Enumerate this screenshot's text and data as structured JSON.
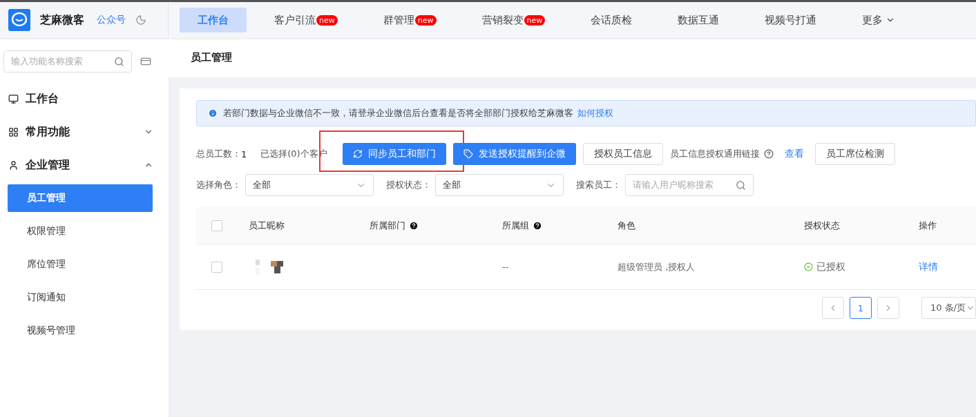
{
  "app": {
    "name": "芝麻微客",
    "account_link": "公众号"
  },
  "nav": [
    {
      "label": "工作台",
      "selected": true
    },
    {
      "label": "客户引流",
      "selected": false,
      "badge": "new"
    },
    {
      "label": "群管理",
      "selected": false,
      "badge": "new"
    },
    {
      "label": "营销裂变",
      "selected": false,
      "badge": "new"
    },
    {
      "label": "会话质检",
      "selected": false
    },
    {
      "label": "数据互通",
      "selected": false
    },
    {
      "label": "视频号打通",
      "selected": false
    },
    {
      "label": "更多",
      "selected": false,
      "dropdown": true
    }
  ],
  "sidebar": {
    "search_placeholder": "输入功能名称搜索",
    "items": [
      {
        "label": "工作台",
        "kind": "link"
      },
      {
        "label": "常用功能",
        "kind": "group",
        "expanded": false
      },
      {
        "label": "企业管理",
        "kind": "group",
        "expanded": true,
        "children": [
          {
            "label": "员工管理",
            "selected": true
          },
          {
            "label": "权限管理",
            "selected": false
          },
          {
            "label": "席位管理",
            "selected": false
          },
          {
            "label": "订阅通知",
            "selected": false
          },
          {
            "label": "视频号管理",
            "selected": false
          }
        ]
      }
    ]
  },
  "page_title": "员工管理",
  "notice": {
    "text": "若部门数据与企业微信不一致，请登录企业微信后台查看是否将全部部门授权给芝麻微客",
    "link": "如何授权"
  },
  "toolbar": [
    {
      "kind": "label",
      "label": "总员工数："
    },
    {
      "kind": "count",
      "label": "1"
    },
    {
      "kind": "text",
      "label": "已选择(0)个客户"
    },
    {
      "kind": "primary",
      "label": "同步员工和部门",
      "highlighted": true
    },
    {
      "kind": "primary",
      "label": "发送授权提醒到企微",
      "highlighted": false
    },
    {
      "kind": "default",
      "label": "授权员工信息",
      "highlighted": false
    },
    {
      "kind": "help",
      "label": "员工信息授权通用链接"
    },
    {
      "kind": "link",
      "label": "查看"
    },
    {
      "kind": "default",
      "label": "员工席位检测",
      "highlighted": false
    }
  ],
  "filters": [
    {
      "label": "选择角色：",
      "kind": "select",
      "value": "全部"
    },
    {
      "label": "授权状态：",
      "kind": "select",
      "value": "全部"
    },
    {
      "label": "搜索员工：",
      "kind": "search",
      "placeholder": "请输入用户昵称搜索"
    }
  ],
  "table": {
    "header_checked": false,
    "columns": [
      {
        "label": "员工昵称",
        "help": false
      },
      {
        "label": "所属部门",
        "help": true
      },
      {
        "label": "所属组",
        "help": true
      },
      {
        "label": "角色",
        "help": false
      },
      {
        "label": "授权状态",
        "help": false
      },
      {
        "label": "操作",
        "help": false
      }
    ],
    "rows": [
      {
        "checked": false,
        "group": "--",
        "role": "超级管理员 ,授权人",
        "status": "已授权",
        "action": "详情"
      }
    ]
  },
  "pagination": {
    "pages": [
      {
        "label": "1",
        "selected": true
      }
    ],
    "page_size": "10 条/页"
  }
}
